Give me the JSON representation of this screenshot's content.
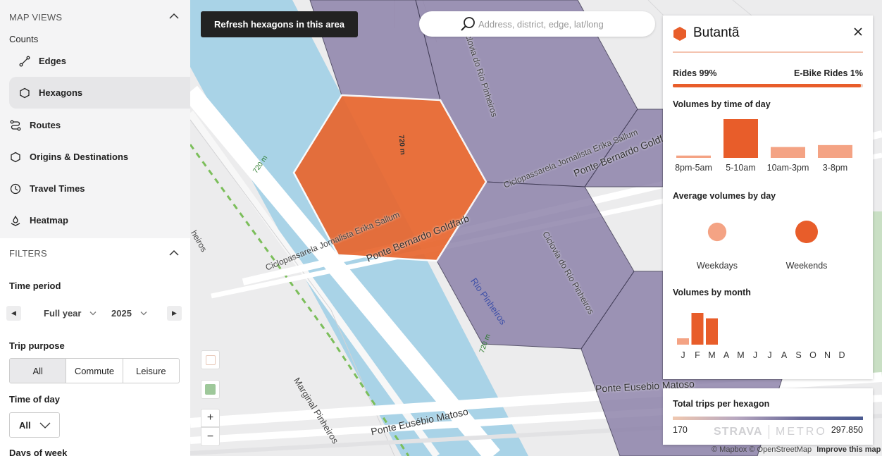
{
  "sidebar": {
    "map_views_heading": "MAP VIEWS",
    "counts_label": "Counts",
    "items": [
      {
        "label": "Edges"
      },
      {
        "label": "Hexagons"
      },
      {
        "label": "Routes"
      },
      {
        "label": "Origins & Destinations"
      },
      {
        "label": "Travel Times"
      },
      {
        "label": "Heatmap"
      }
    ],
    "filters_heading": "FILTERS",
    "time_period_label": "Time period",
    "period_value": "Full year",
    "year_value": "2025",
    "trip_purpose_label": "Trip purpose",
    "trip_purpose_options": [
      "All",
      "Commute",
      "Leisure"
    ],
    "time_of_day_label": "Time of day",
    "time_of_day_value": "All",
    "days_of_week_label": "Days of week"
  },
  "map": {
    "refresh_label": "Refresh hexagons in this area",
    "search_placeholder": "Address, district, edge, lat/long",
    "labels": {
      "road1": "Ciclopassarela Jornalista Erika Sallum",
      "road2": "Ciclopassarela Jornalista Erika Sallum",
      "bridge1": "Ponte Bernardo Goldfarb",
      "bridge2": "Ponte Bernardo Goldf",
      "cycle1": "Ciclovia do Rio Pinheiros",
      "cycle2": "Ciclovia do Rio Pinheiros",
      "river": "Rio Pinheiros",
      "marginal": "Marginal Pinheiros",
      "eusebio1": "Ponte Eusébio Matoso",
      "eusebio2": "Ponte Eusebio Matoso",
      "dist720a": "720 m",
      "dist720b": "720 m",
      "dist720c": "720 m",
      "pinheiros_frag": "heiros"
    },
    "zoom_in": "+",
    "zoom_out": "−",
    "attribution": "© Mapbox © OpenStreetMap",
    "improve_link": "Improve this map"
  },
  "panel": {
    "title": "Butantã",
    "rides_label": "Rides 99%",
    "ebike_label": "E-Bike Rides 1%",
    "rides_fraction": 0.99,
    "time_of_day_title": "Volumes by time of day",
    "time_of_day": [
      {
        "label": "8pm-5am",
        "value": 0.06
      },
      {
        "label": "5-10am",
        "value": 1.0
      },
      {
        "label": "10am-3pm",
        "value": 0.28
      },
      {
        "label": "3-8pm",
        "value": 0.33
      }
    ],
    "avg_by_day_title": "Average volumes by day",
    "avg_by_day": [
      {
        "label": "Weekdays",
        "value": 0.82
      },
      {
        "label": "Weekends",
        "value": 1.0
      }
    ],
    "by_month_title": "Volumes by month",
    "months": [
      "J",
      "F",
      "M",
      "A",
      "M",
      "J",
      "J",
      "A",
      "S",
      "O",
      "N",
      "D"
    ],
    "month_values": [
      0.2,
      1.0,
      0.83,
      0,
      0,
      0,
      0,
      0,
      0,
      0,
      0,
      0
    ]
  },
  "legend": {
    "title": "Total trips per hexagon",
    "min": "170",
    "max": "297.850",
    "brand_left": "STRAVA",
    "brand_right": "METRO"
  },
  "colors": {
    "accent": "#e85d2a",
    "accent_light": "#f4a384",
    "hexagon_purple": "#8a7fa8",
    "water": "#a9d3e7"
  }
}
